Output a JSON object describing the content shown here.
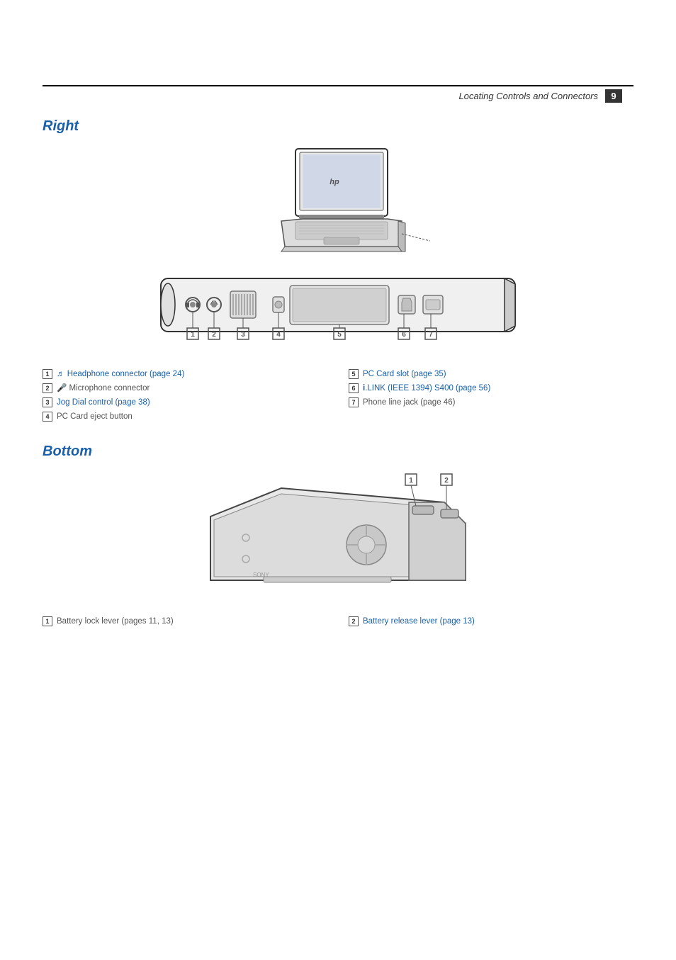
{
  "header": {
    "title": "Locating Controls and Connectors",
    "page_number": "9"
  },
  "right_section": {
    "heading": "Right",
    "labels": [
      {
        "num": "1",
        "text": "Headphone connector (page 24)",
        "style": "blue"
      },
      {
        "num": "5",
        "text": "PC Card slot (page 35)",
        "style": "blue"
      },
      {
        "num": "2",
        "text": "Microphone connector",
        "style": "plain"
      },
      {
        "num": "6",
        "text": "i.LINK (IEEE 1394) S400 (page 56)",
        "style": "blue"
      },
      {
        "num": "3",
        "text": "Jog Dial control (page 38)",
        "style": "blue"
      },
      {
        "num": "7",
        "text": "Phone line jack (page 46)",
        "style": "plain"
      },
      {
        "num": "4",
        "text": "PC Card eject button",
        "style": "plain"
      },
      {
        "num": "",
        "text": "",
        "style": "empty"
      }
    ]
  },
  "bottom_section": {
    "heading": "Bottom",
    "labels": [
      {
        "num": "1",
        "text": "Battery lock lever (pages 11, 13)",
        "style": "plain"
      },
      {
        "num": "2",
        "text": "Battery release lever (page 13)",
        "style": "blue"
      }
    ]
  }
}
